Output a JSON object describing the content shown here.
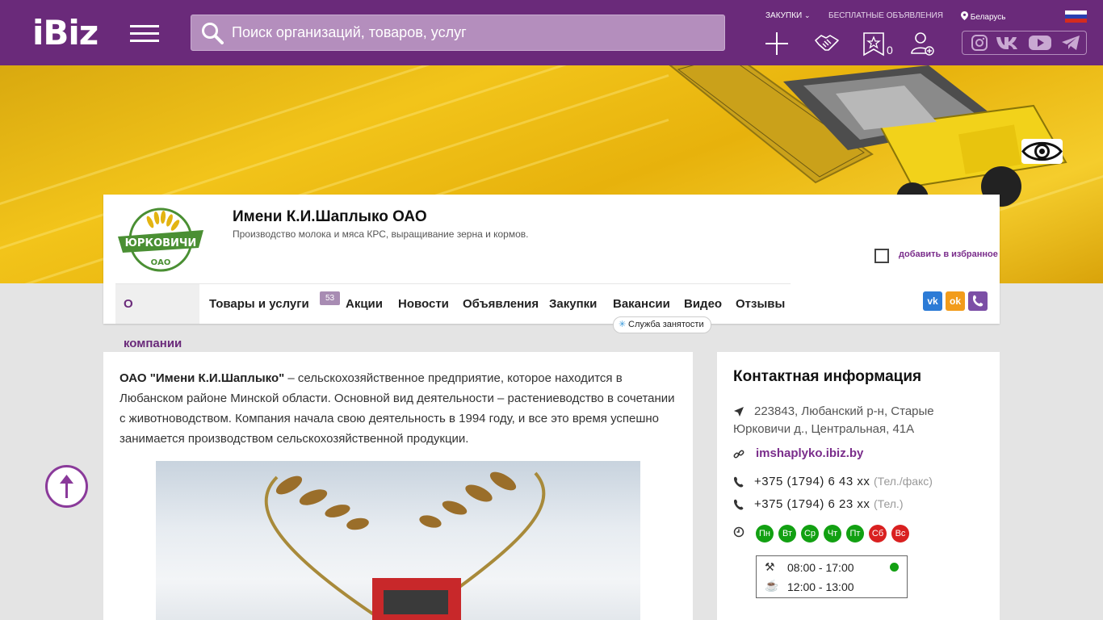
{
  "header": {
    "logo": "iBiz",
    "search_placeholder": "Поиск организаций, товаров, услуг",
    "zakupki_label": "ЗАКУПКИ",
    "free_ads_label": "БЕСПЛАТНЫЕ ОБЪЯВЛЕНИЯ",
    "region_label": "Беларусь",
    "favorites_count": "0",
    "brand_color": "#6a2a7a"
  },
  "company": {
    "logo_text": "ЮРКОВИЧИ",
    "logo_subtext": "ОАО",
    "name": "Имени К.И.Шаплыко ОАО",
    "description": "Производство молока и мяса КРС, выращивание зерна и кормов.",
    "add_favorite_label": "добавить в избранное"
  },
  "tabs": [
    {
      "label": "О компании",
      "active": true
    },
    {
      "label": "Товары и услуги",
      "badge": "53"
    },
    {
      "label": "Акции"
    },
    {
      "label": "Новости"
    },
    {
      "label": "Объявления"
    },
    {
      "label": "Закупки"
    },
    {
      "label": "Вакансии"
    },
    {
      "label": "Видео"
    },
    {
      "label": "Отзывы"
    }
  ],
  "vacancy_tooltip": "Служба занятости",
  "about": {
    "company_quoted": "ОАО \"Имени К.И.Шаплыко\"",
    "text": " – сельскохозяйственное предприятие, которое находится в Любанском районе Минской области. Основной вид деятельности – растениеводство в сочетании с животноводством. Компания начала свою деятельность в 1994 году, и все это время успешно занимается производством сельскохозяйственной продукции."
  },
  "contact": {
    "title": "Контактная информация",
    "address": "223843, Любанский р-н, Старые Юрковичи д., Центральная, 41А",
    "website": "imshaplyko.ibiz.by",
    "phones": [
      {
        "number": "+375 (1794) 6 43 xx",
        "note": "(Тел./факс)"
      },
      {
        "number": "+375 (1794) 6 23 xx",
        "note": "(Тел.)"
      }
    ],
    "days": [
      {
        "label": "Пн",
        "status": "work"
      },
      {
        "label": "Вт",
        "status": "work"
      },
      {
        "label": "Ср",
        "status": "work"
      },
      {
        "label": "Чт",
        "status": "work"
      },
      {
        "label": "Пт",
        "status": "work"
      },
      {
        "label": "Сб",
        "status": "off"
      },
      {
        "label": "Вс",
        "status": "off"
      }
    ],
    "work_hours": "08:00 - 17:00",
    "lunch_hours": "12:00 - 13:00"
  }
}
